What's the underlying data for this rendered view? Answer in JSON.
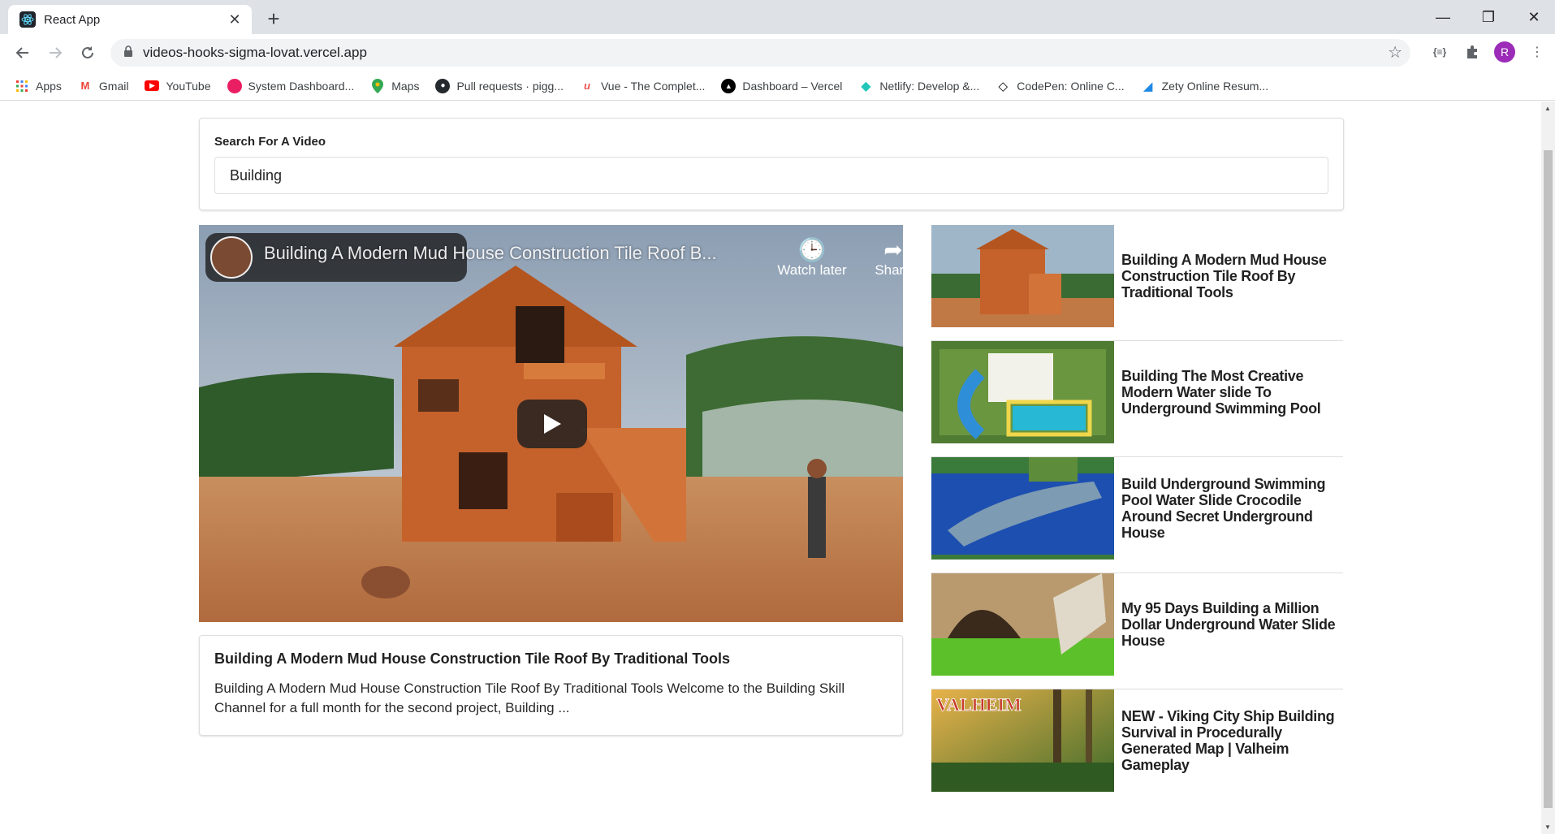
{
  "browser": {
    "tab_title": "React App",
    "url": "videos-hooks-sigma-lovat.vercel.app",
    "profile_initial": "R",
    "bookmarks": [
      {
        "label": "Apps",
        "icon": "apps-grid-icon",
        "color": "#ea4335"
      },
      {
        "label": "Gmail",
        "icon": "gmail-icon",
        "color": "#ea4335"
      },
      {
        "label": "YouTube",
        "icon": "youtube-icon",
        "color": "#ff0000"
      },
      {
        "label": "System Dashboard...",
        "icon": "dashboard-icon",
        "color": "#e91e63"
      },
      {
        "label": "Maps",
        "icon": "maps-pin-icon",
        "color": "#34a853"
      },
      {
        "label": "Pull requests · pigg...",
        "icon": "github-icon",
        "color": "#24292e"
      },
      {
        "label": "Vue - The Complet...",
        "icon": "udemy-icon",
        "color": "#ec5252"
      },
      {
        "label": "Dashboard – Vercel",
        "icon": "vercel-icon",
        "color": "#000000"
      },
      {
        "label": "Netlify: Develop &...",
        "icon": "netlify-icon",
        "color": "#20c6b7"
      },
      {
        "label": "CodePen: Online C...",
        "icon": "codepen-icon",
        "color": "#000000"
      },
      {
        "label": "Zety Online Resum...",
        "icon": "zety-icon",
        "color": "#1e88e5"
      }
    ]
  },
  "search": {
    "label": "Search For A Video",
    "value": "Building"
  },
  "player": {
    "overlay_title": "Building A Modern Mud House Construction Tile Roof B...",
    "watch_later": "Watch later",
    "share": "Share"
  },
  "detail": {
    "title": "Building A Modern Mud House Construction Tile Roof By Traditional Tools",
    "description": "Building A Modern Mud House Construction Tile Roof By Traditional Tools Welcome to the Building Skill Channel for a full month for the second project, Building ..."
  },
  "video_list": [
    {
      "title": "Building A Modern Mud House Construction Tile Roof By Traditional Tools",
      "thumb": "mud-house"
    },
    {
      "title": "Building The Most Creative Modern Water slide To Underground Swimming Pool",
      "thumb": "water-slide"
    },
    {
      "title": "Build Underground Swimming Pool Water Slide Crocodile Around Secret Underground House",
      "thumb": "crocodile-pool"
    },
    {
      "title": "My 95 Days Building a Million Dollar Underground Water Slide House",
      "thumb": "green-pool"
    },
    {
      "title": "NEW - Viking City Ship Building Survival in Procedurally Generated Map | Valheim Gameplay",
      "thumb": "valheim",
      "thumb_text": "VALHEIM"
    }
  ]
}
